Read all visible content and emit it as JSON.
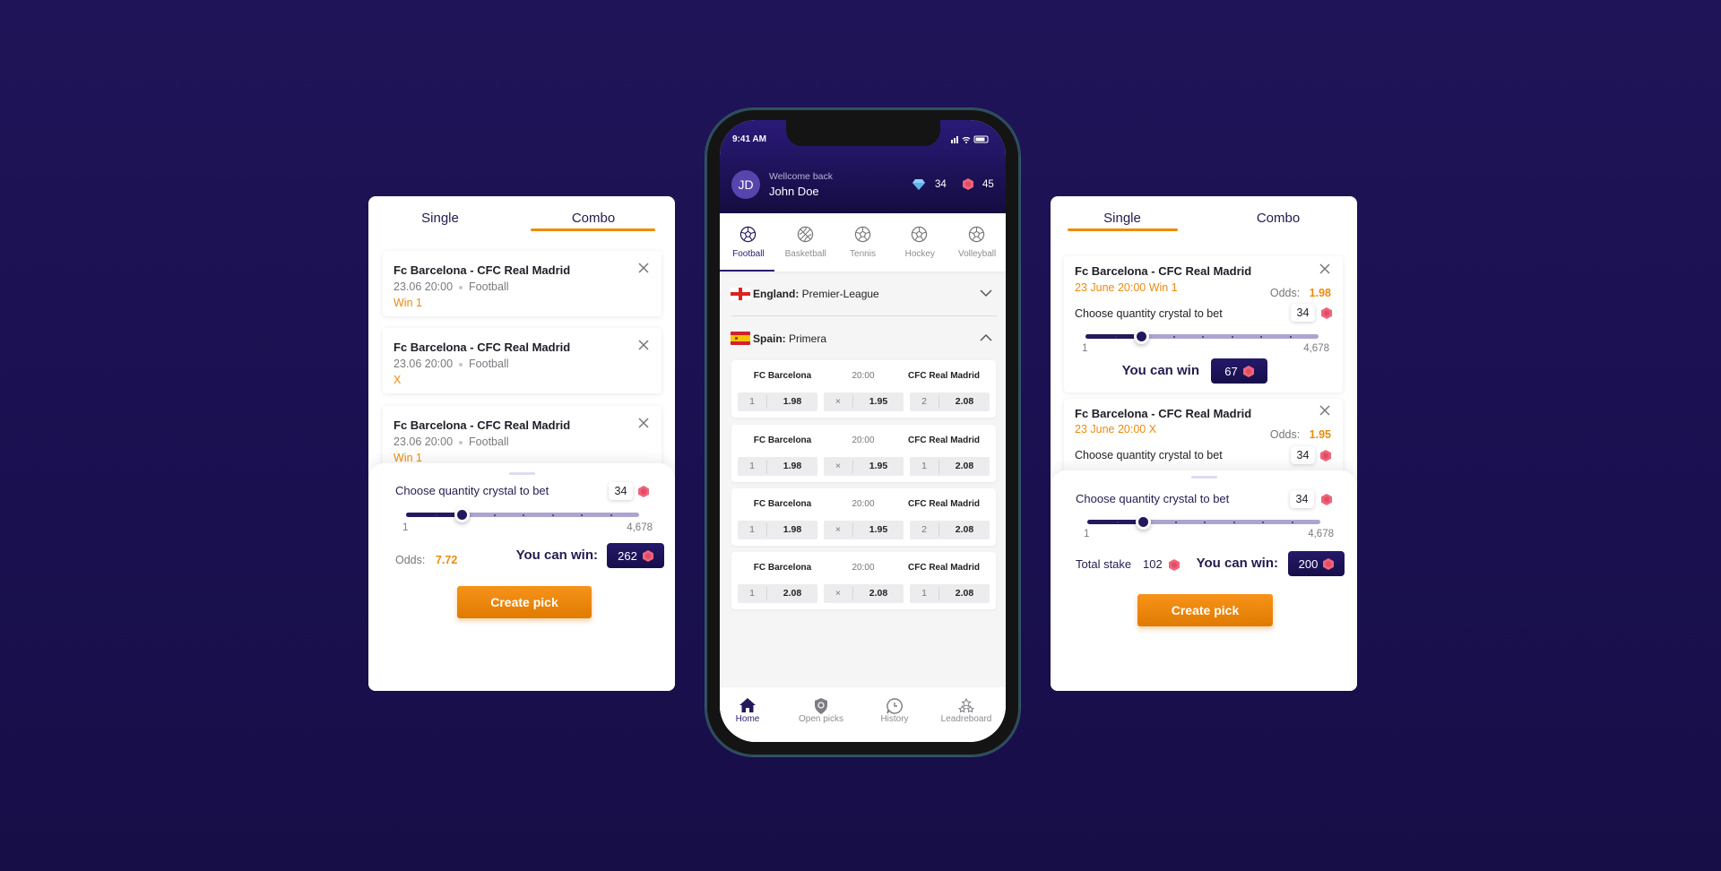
{
  "colors": {
    "background": "#1d1352",
    "accent_orange": "#f08a00",
    "navy": "#1d1452",
    "crystal": "#f0647a",
    "gem": "#8fd0ff"
  },
  "left_panel": {
    "tabs": [
      {
        "label": "Single",
        "active": false
      },
      {
        "label": "Combo",
        "active": true
      }
    ],
    "picks": [
      {
        "title": "Fc Barcelona - CFC Real Madrid",
        "date": "23.06 20:00",
        "sport": "Football",
        "pick": "Win 1"
      },
      {
        "title": "Fc Barcelona - CFC Real Madrid",
        "date": "23.06 20:00",
        "sport": "Football",
        "pick": "X"
      },
      {
        "title": "Fc Barcelona - CFC Real Madrid",
        "date": "23.06 20:00",
        "sport": "Football",
        "pick": "Win 1"
      }
    ],
    "sheet": {
      "choose_label": "Choose quantity crystal to bet",
      "stake": "34",
      "slider_min": "1",
      "slider_max": "4,678",
      "slider_position": 0.24,
      "odds_label": "Odds:",
      "odds_value": "7.72",
      "win_label": "You can win:",
      "win_value": "262",
      "button": "Create pick"
    }
  },
  "phone": {
    "status_time": "9:41 AM",
    "user": {
      "initials": "JD",
      "greeting": "Wellcome back",
      "name": "John Doe"
    },
    "gems": "34",
    "crystals": "45",
    "sports_tabs": [
      {
        "label": "Football",
        "icon": "soccer-ball-icon",
        "active": true
      },
      {
        "label": "Basketball",
        "icon": "basketball-icon",
        "active": false
      },
      {
        "label": "Tennis",
        "icon": "ball-icon",
        "active": false
      },
      {
        "label": "Hockey",
        "icon": "ball-icon",
        "active": false
      },
      {
        "label": "Volleyball",
        "icon": "ball-icon",
        "active": false
      }
    ],
    "leagues": [
      {
        "country": "England:",
        "name": "Premier-League",
        "expanded": false
      },
      {
        "country": "Spain:",
        "name": "Primera",
        "expanded": true
      }
    ],
    "matches": [
      {
        "home": "FC Barcelona",
        "time": "20:00",
        "away": "CFC Real Madrid",
        "odds": [
          {
            "k": "1",
            "v": "1.98"
          },
          {
            "k": "×",
            "v": "1.95"
          },
          {
            "k": "2",
            "v": "2.08"
          }
        ]
      },
      {
        "home": "FC Barcelona",
        "time": "20:00",
        "away": "CFC Real Madrid",
        "odds": [
          {
            "k": "1",
            "v": "1.98"
          },
          {
            "k": "×",
            "v": "1.95"
          },
          {
            "k": "1",
            "v": "2.08"
          }
        ]
      },
      {
        "home": "FC Barcelona",
        "time": "20:00",
        "away": "CFC Real Madrid",
        "odds": [
          {
            "k": "1",
            "v": "1.98"
          },
          {
            "k": "×",
            "v": "1.95"
          },
          {
            "k": "2",
            "v": "2.08"
          }
        ]
      },
      {
        "home": "FC Barcelona",
        "time": "20:00",
        "away": "CFC Real Madrid",
        "odds": [
          {
            "k": "1",
            "v": "2.08"
          },
          {
            "k": "×",
            "v": "2.08"
          },
          {
            "k": "1",
            "v": "2.08"
          }
        ]
      }
    ],
    "nav": [
      {
        "label": "Home",
        "icon": "home-icon",
        "active": true
      },
      {
        "label": "Open picks",
        "icon": "shield-icon",
        "active": false
      },
      {
        "label": "History",
        "icon": "clock-icon",
        "active": false
      },
      {
        "label": "Leadreboard",
        "icon": "stars-icon",
        "active": false
      }
    ]
  },
  "right_panel": {
    "tabs": [
      {
        "label": "Single",
        "active": true
      },
      {
        "label": "Combo",
        "active": false
      }
    ],
    "picks": [
      {
        "title": "Fc Barcelona - CFC Real Madrid",
        "detail": "23 June 20:00 Win 1",
        "odds_label": "Odds:",
        "odds_value": "1.98",
        "choose_label": "Choose quantity crystal to bet",
        "stake": "34",
        "slider_min": "1",
        "slider_max": "4,678",
        "slider_position": 0.24,
        "win_label": "You can win",
        "win_value": "67"
      },
      {
        "title": "Fc Barcelona - CFC Real Madrid",
        "detail": "23 June 20:00 X",
        "odds_label": "Odds:",
        "odds_value": "1.95",
        "choose_label": "Choose quantity crystal to bet",
        "stake": "34"
      }
    ],
    "sheet": {
      "choose_label": "Choose quantity crystal to bet",
      "stake": "34",
      "slider_min": "1",
      "slider_max": "4,678",
      "slider_position": 0.24,
      "total_label": "Total stake",
      "total_value": "102",
      "win_label": "You can win:",
      "win_value": "200",
      "button": "Create pick"
    }
  }
}
